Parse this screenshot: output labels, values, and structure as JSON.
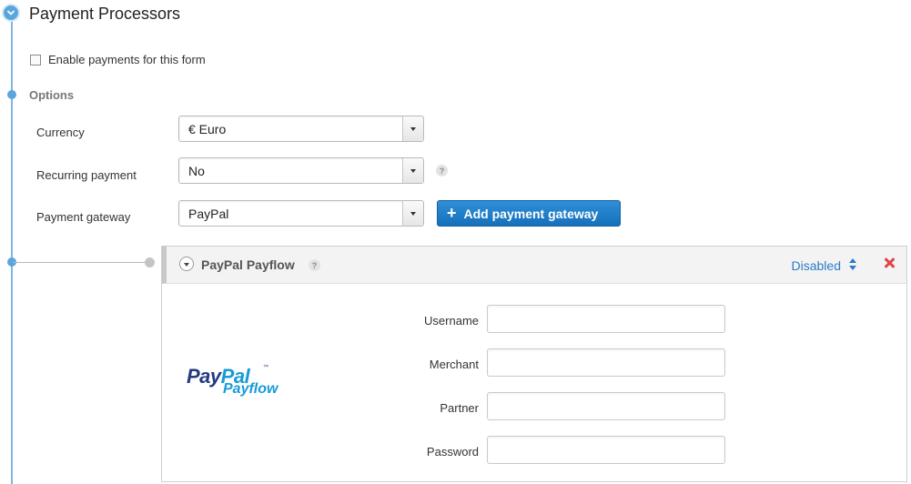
{
  "section": {
    "title": "Payment Processors",
    "enable_label": "Enable payments for this form",
    "options_title": "Options"
  },
  "fields": {
    "currency": {
      "label": "Currency",
      "value": "€ Euro"
    },
    "recurring": {
      "label": "Recurring payment",
      "value": "No",
      "help": "?"
    },
    "gateway": {
      "label": "Payment gateway",
      "value": "PayPal"
    }
  },
  "add_button": {
    "label": "Add payment gateway",
    "icon": "plus-icon"
  },
  "panel": {
    "title": "PayPal Payflow",
    "help": "?",
    "status": "Disabled",
    "logo": {
      "brand_pay": "Pay",
      "brand_pal": "Pal",
      "tm": "™",
      "sub": "Payflow"
    },
    "credentials": [
      {
        "label": "Username",
        "value": ""
      },
      {
        "label": "Merchant",
        "value": ""
      },
      {
        "label": "Partner",
        "value": ""
      },
      {
        "label": "Password",
        "value": ""
      }
    ]
  },
  "colors": {
    "accent": "#2a7cc7",
    "button": "#1f7fcb",
    "timeline": "#5aa6dc",
    "remove": "#e04545"
  }
}
